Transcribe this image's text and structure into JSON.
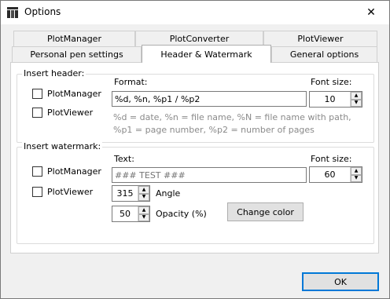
{
  "window": {
    "title": "Options",
    "close_label": "✕"
  },
  "tabs": {
    "row1": [
      "PlotManager",
      "PlotConverter",
      "PlotViewer"
    ],
    "row2": [
      "Personal pen settings",
      "Header & Watermark",
      "General options"
    ],
    "selected": "Header & Watermark"
  },
  "insert_header": {
    "group_label": "Insert header:",
    "plotmanager_label": "PlotManager",
    "plotviewer_label": "PlotViewer",
    "plotmanager_checked": false,
    "plotviewer_checked": false,
    "format_label": "Format:",
    "format_value": "%d, %n, %p1 / %p2",
    "font_size_label": "Font size:",
    "font_size_value": "10",
    "hint_line1": "%d = date, %n = file name, %N = file name with path,",
    "hint_line2": "%p1 = page number, %p2 = number of pages"
  },
  "insert_watermark": {
    "group_label": "Insert watermark:",
    "plotmanager_label": "PlotManager",
    "plotviewer_label": "PlotViewer",
    "plotmanager_checked": false,
    "plotviewer_checked": false,
    "text_label": "Text:",
    "text_placeholder": "### TEST ###",
    "font_size_label": "Font size:",
    "font_size_value": "60",
    "angle_value": "315",
    "angle_label": "Angle",
    "opacity_value": "50",
    "opacity_label": "Opacity (%)",
    "change_color_label": "Change color"
  },
  "ok_label": "OK"
}
